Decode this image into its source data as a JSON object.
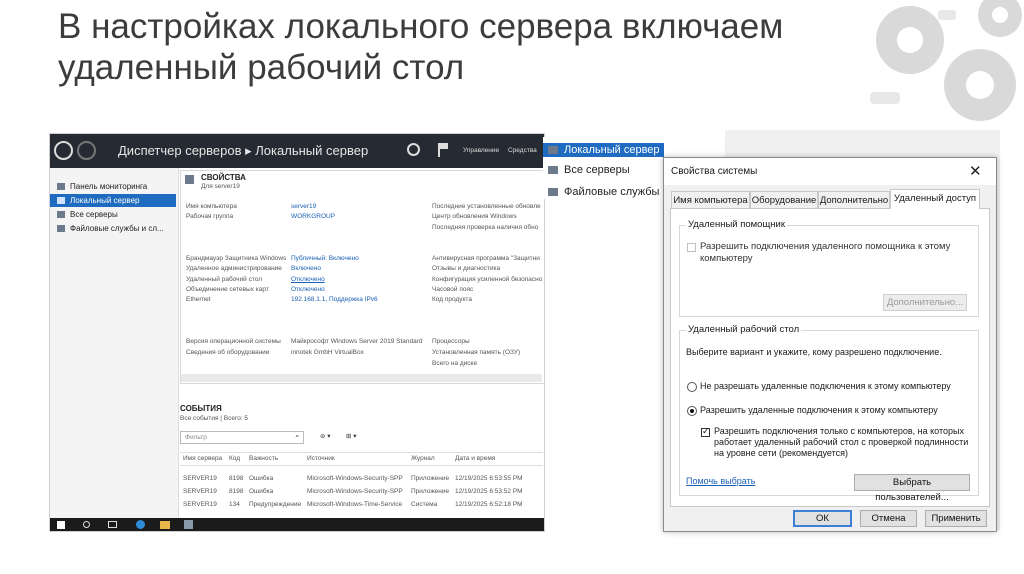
{
  "slide": {
    "title_line1": "В настройках локального сервера включаем",
    "title_line2": "удаленный рабочий стол"
  },
  "server_manager": {
    "breadcrumb": "Диспетчер серверов ▸ Локальный сервер",
    "top_menu": {
      "manage": "Управление",
      "tools": "Средства"
    },
    "sidebar": [
      {
        "label": "Панель мониторинга",
        "selected": false
      },
      {
        "label": "Локальный сервер",
        "selected": true
      },
      {
        "label": "Все серверы",
        "selected": false
      },
      {
        "label": "Файловые службы и сл...",
        "selected": false
      }
    ],
    "properties": {
      "heading": "СВОЙСТВА",
      "subheading": "Для server19",
      "rows_left": [
        {
          "label": "Имя компьютера",
          "value": "server19"
        },
        {
          "label": "Рабочая группа",
          "value": "WORKGROUP"
        },
        {
          "label": "Брандмауэр Защитника Windows",
          "value": "Публичный: Включено"
        },
        {
          "label": "Удаленное администрирование",
          "value": "Включено"
        },
        {
          "label": "Удаленный рабочий стол",
          "value": "Отключено"
        },
        {
          "label": "Объединение сетевых карт",
          "value": "Отключено"
        },
        {
          "label": "Ethernet",
          "value": "192.168.1.1, Поддержка IPv6"
        },
        {
          "label": "Версия операционной системы",
          "value": "Майкрософт Windows Server 2019 Standard"
        },
        {
          "label": "Сведения об оборудовании",
          "value": "innotek GmbH VirtualBox"
        }
      ],
      "rows_right": [
        "Последние установленные обновле",
        "Центр обновления Windows",
        "Последняя проверка наличия обно",
        "Антивирусная программа \"Защитни",
        "Отзывы и диагностика",
        "Конфигурация усиленной безопасно",
        "Часовой пояс",
        "Код продукта",
        "Процессоры",
        "Установленная память (ОЗУ)",
        "Всего на диске"
      ]
    },
    "events": {
      "heading": "СОБЫТИЯ",
      "subheading": "Все события | Всего: 5",
      "filter_placeholder": "Фильтр",
      "columns": [
        "Имя сервера",
        "Код",
        "Важность",
        "Источник",
        "Журнал",
        "Дата и время"
      ],
      "rows": [
        [
          "SERVER19",
          "8198",
          "Ошибка",
          "Microsoft-Windows-Security-SPP",
          "Приложение",
          "12/19/2025 6:53:55 PM"
        ],
        [
          "SERVER19",
          "8198",
          "Ошибка",
          "Microsoft-Windows-Security-SPP",
          "Приложение",
          "12/19/2025 6:53:52 PM"
        ],
        [
          "SERVER19",
          "134",
          "Предупреждение",
          "Microsoft-Windows-Time-Service",
          "Система",
          "12/19/2025 6:52:18 PM"
        ]
      ]
    }
  },
  "mid_panel": {
    "items": [
      {
        "label": "Локальный сервер",
        "selected": true
      },
      {
        "label": "Все серверы",
        "selected": false
      },
      {
        "label": "Файловые службы",
        "selected": false
      }
    ]
  },
  "dialog": {
    "title": "Свойства системы",
    "tabs": [
      "Имя компьютера",
      "Оборудование",
      "Дополнительно",
      "Удаленный доступ"
    ],
    "active_tab": "Удаленный доступ",
    "assistance": {
      "group_label": "Удаленный помощник",
      "checkbox_line1": "Разрешить подключения удаленного помощника к этому",
      "checkbox_line2": "компьютеру",
      "checked": false,
      "advanced_button": "Дополнительно..."
    },
    "rdp": {
      "group_label": "Удаленный рабочий стол",
      "instruction": "Выберите вариант и укажите, кому разрешено подключение.",
      "option_deny": "Не разрешать удаленные подключения к этому компьютеру",
      "option_allow": "Разрешить удаленные подключения к этому компьютеру",
      "selected_option": "allow",
      "nla_line1": "Разрешить подключения только с компьютеров, на которых",
      "nla_line2": "работает удаленный рабочий стол с проверкой подлинности",
      "nla_line3": "на уровне сети (рекомендуется)",
      "nla_checked": true,
      "help_link": "Помочь выбрать",
      "select_users_button": "Выбрать пользователей..."
    },
    "buttons": {
      "ok": "ОК",
      "cancel": "Отмена",
      "apply": "Применить"
    }
  }
}
